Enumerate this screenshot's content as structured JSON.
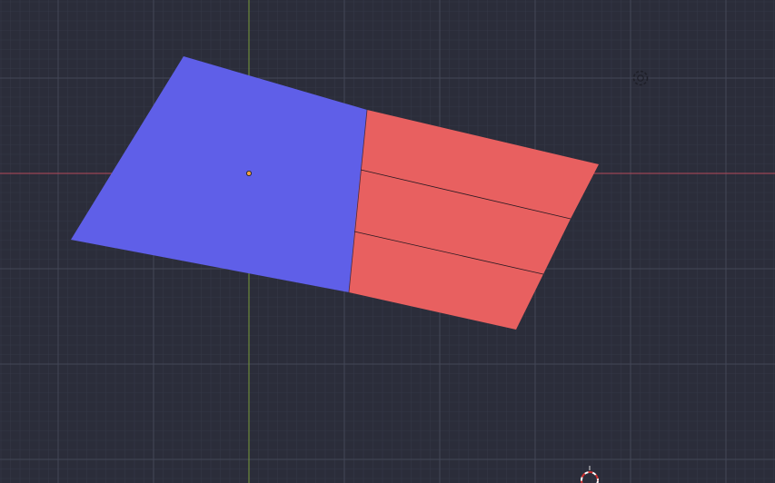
{
  "viewport": {
    "view": "3d-viewport-top-view",
    "grid_visible": true,
    "axes": [
      "x-axis",
      "y-axis"
    ]
  },
  "mesh": {
    "object": "plane",
    "faces": [
      {
        "name": "face-left",
        "selected": false
      },
      {
        "name": "face-right-top",
        "selected": true
      },
      {
        "name": "face-right-middle",
        "selected": true
      },
      {
        "name": "face-right-bottom",
        "selected": true
      }
    ]
  },
  "colors": {
    "background": "#2b2d3a",
    "grid_minor": "#353847",
    "grid_major": "#434657",
    "x_axis": "#b6495a",
    "y_axis": "#7a9a3b",
    "face_unselected": "#5f5fe8",
    "face_selected": "#e86060",
    "edge": "#2a1a22",
    "origin": "#f0a040"
  },
  "icons": {
    "light": "light-sun-icon",
    "cursor": "3d-cursor-icon",
    "origin": "object-origin-icon"
  }
}
